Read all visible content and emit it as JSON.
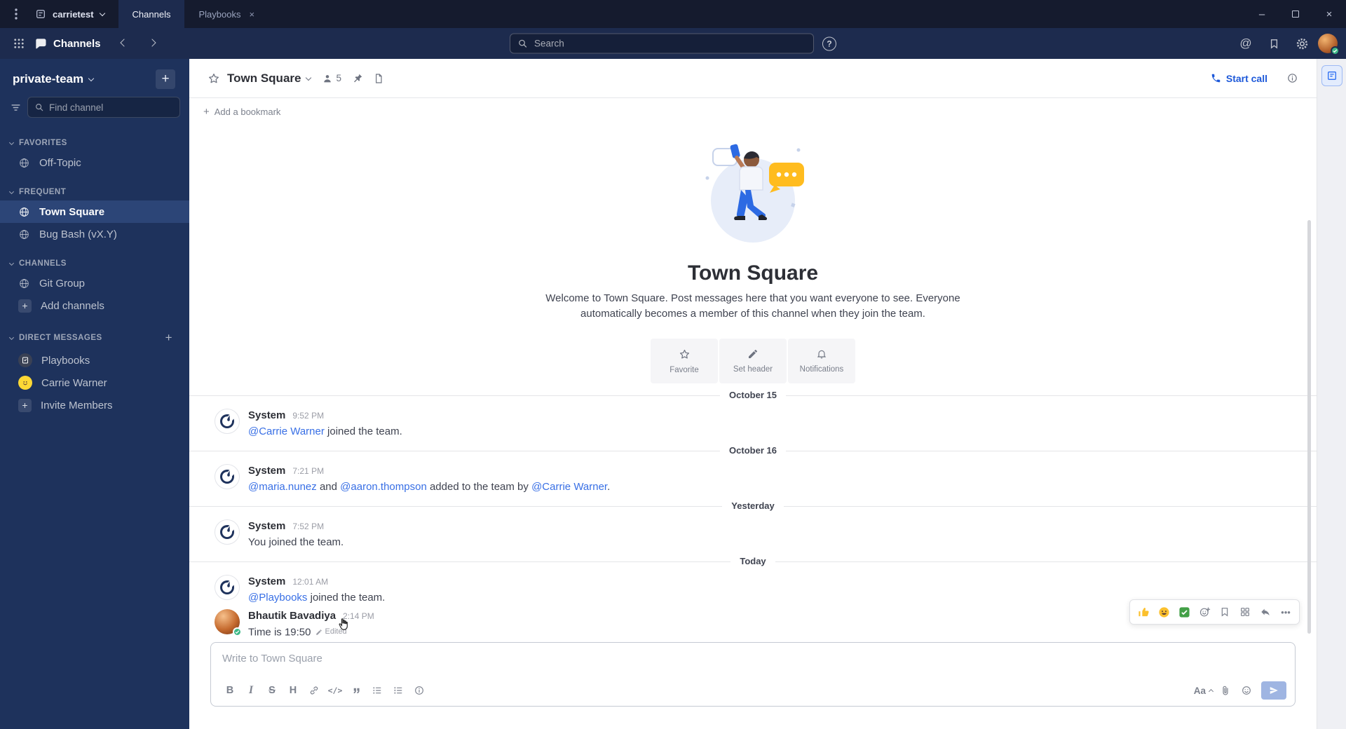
{
  "titlebar": {
    "server_name": "carrietest",
    "tab_channels": "Channels",
    "tab_playbooks": "Playbooks"
  },
  "global_header": {
    "product_title": "Channels",
    "search_placeholder": "Search"
  },
  "sidebar": {
    "team_name": "private-team",
    "find_channel_placeholder": "Find channel",
    "sections": {
      "favorites": "FAVORITES",
      "frequent": "FREQUENT",
      "channels": "CHANNELS",
      "direct_messages": "DIRECT MESSAGES"
    },
    "items": {
      "off_topic": "Off-Topic",
      "town_square": "Town Square",
      "bug_bash": "Bug Bash (vX.Y)",
      "git_group": "Git Group",
      "add_channels": "Add channels",
      "playbooks": "Playbooks",
      "carrie_warner": "Carrie Warner",
      "invite_members": "Invite Members"
    }
  },
  "channel_header": {
    "title": "Town Square",
    "member_count": "5",
    "start_call_label": "Start call"
  },
  "bookmark_bar": {
    "add_label": "Add a bookmark"
  },
  "intro": {
    "title": "Town Square",
    "description": "Welcome to Town Square. Post messages here that you want everyone to see. Everyone automatically becomes a member of this channel when they join the team.",
    "favorite_label": "Favorite",
    "set_header_label": "Set header",
    "notifications_label": "Notifications"
  },
  "dividers": {
    "d1": "October 15",
    "d2": "October 16",
    "d3": "Yesterday",
    "d4": "Today"
  },
  "messages": {
    "m1": {
      "sender": "System",
      "time": "9:52 PM",
      "link1": "@Carrie Warner",
      "text1": " joined the team."
    },
    "m2": {
      "sender": "System",
      "time": "7:21 PM",
      "link1": "@maria.nunez",
      "text1": " and ",
      "link2": "@aaron.thompson",
      "text2": " added to the team by ",
      "link3": "@Carrie Warner",
      "text3": "."
    },
    "m3": {
      "sender": "System",
      "time": "7:52 PM",
      "text1": "You joined the team."
    },
    "m4": {
      "sender": "System",
      "time": "12:01 AM",
      "link1": "@Playbooks",
      "text1": " joined the team."
    },
    "m5": {
      "sender": "Bhautik Bavadiya",
      "time": "2:14 PM",
      "text1": "Time is 19:50",
      "edited_label": "Edited"
    }
  },
  "hover_toolbar": {
    "quick_reactions": [
      "thumbsup-emoji",
      "smile-emoji",
      "white-check-mark-emoji"
    ]
  },
  "composer": {
    "placeholder": "Write to Town Square",
    "bold": "B",
    "italic": "I",
    "strike": "S",
    "heading": "H",
    "code": "</>",
    "font_size_label": "Aa"
  },
  "icons": {
    "close": "×",
    "minimize": "–",
    "plus": "+",
    "at_mention": "@",
    "help": "?",
    "more_dots": "•••"
  },
  "colors": {
    "titlebar_bg": "#151b2e",
    "header_bg": "#1d2b4e",
    "sidebar_bg": "#1e325c",
    "selected_channel_bg": "#2c4577",
    "link_blue": "#386fe5",
    "call_blue": "#1c58d9",
    "online_green": "#3db887",
    "bubble_yellow": "#ffbc1f"
  }
}
